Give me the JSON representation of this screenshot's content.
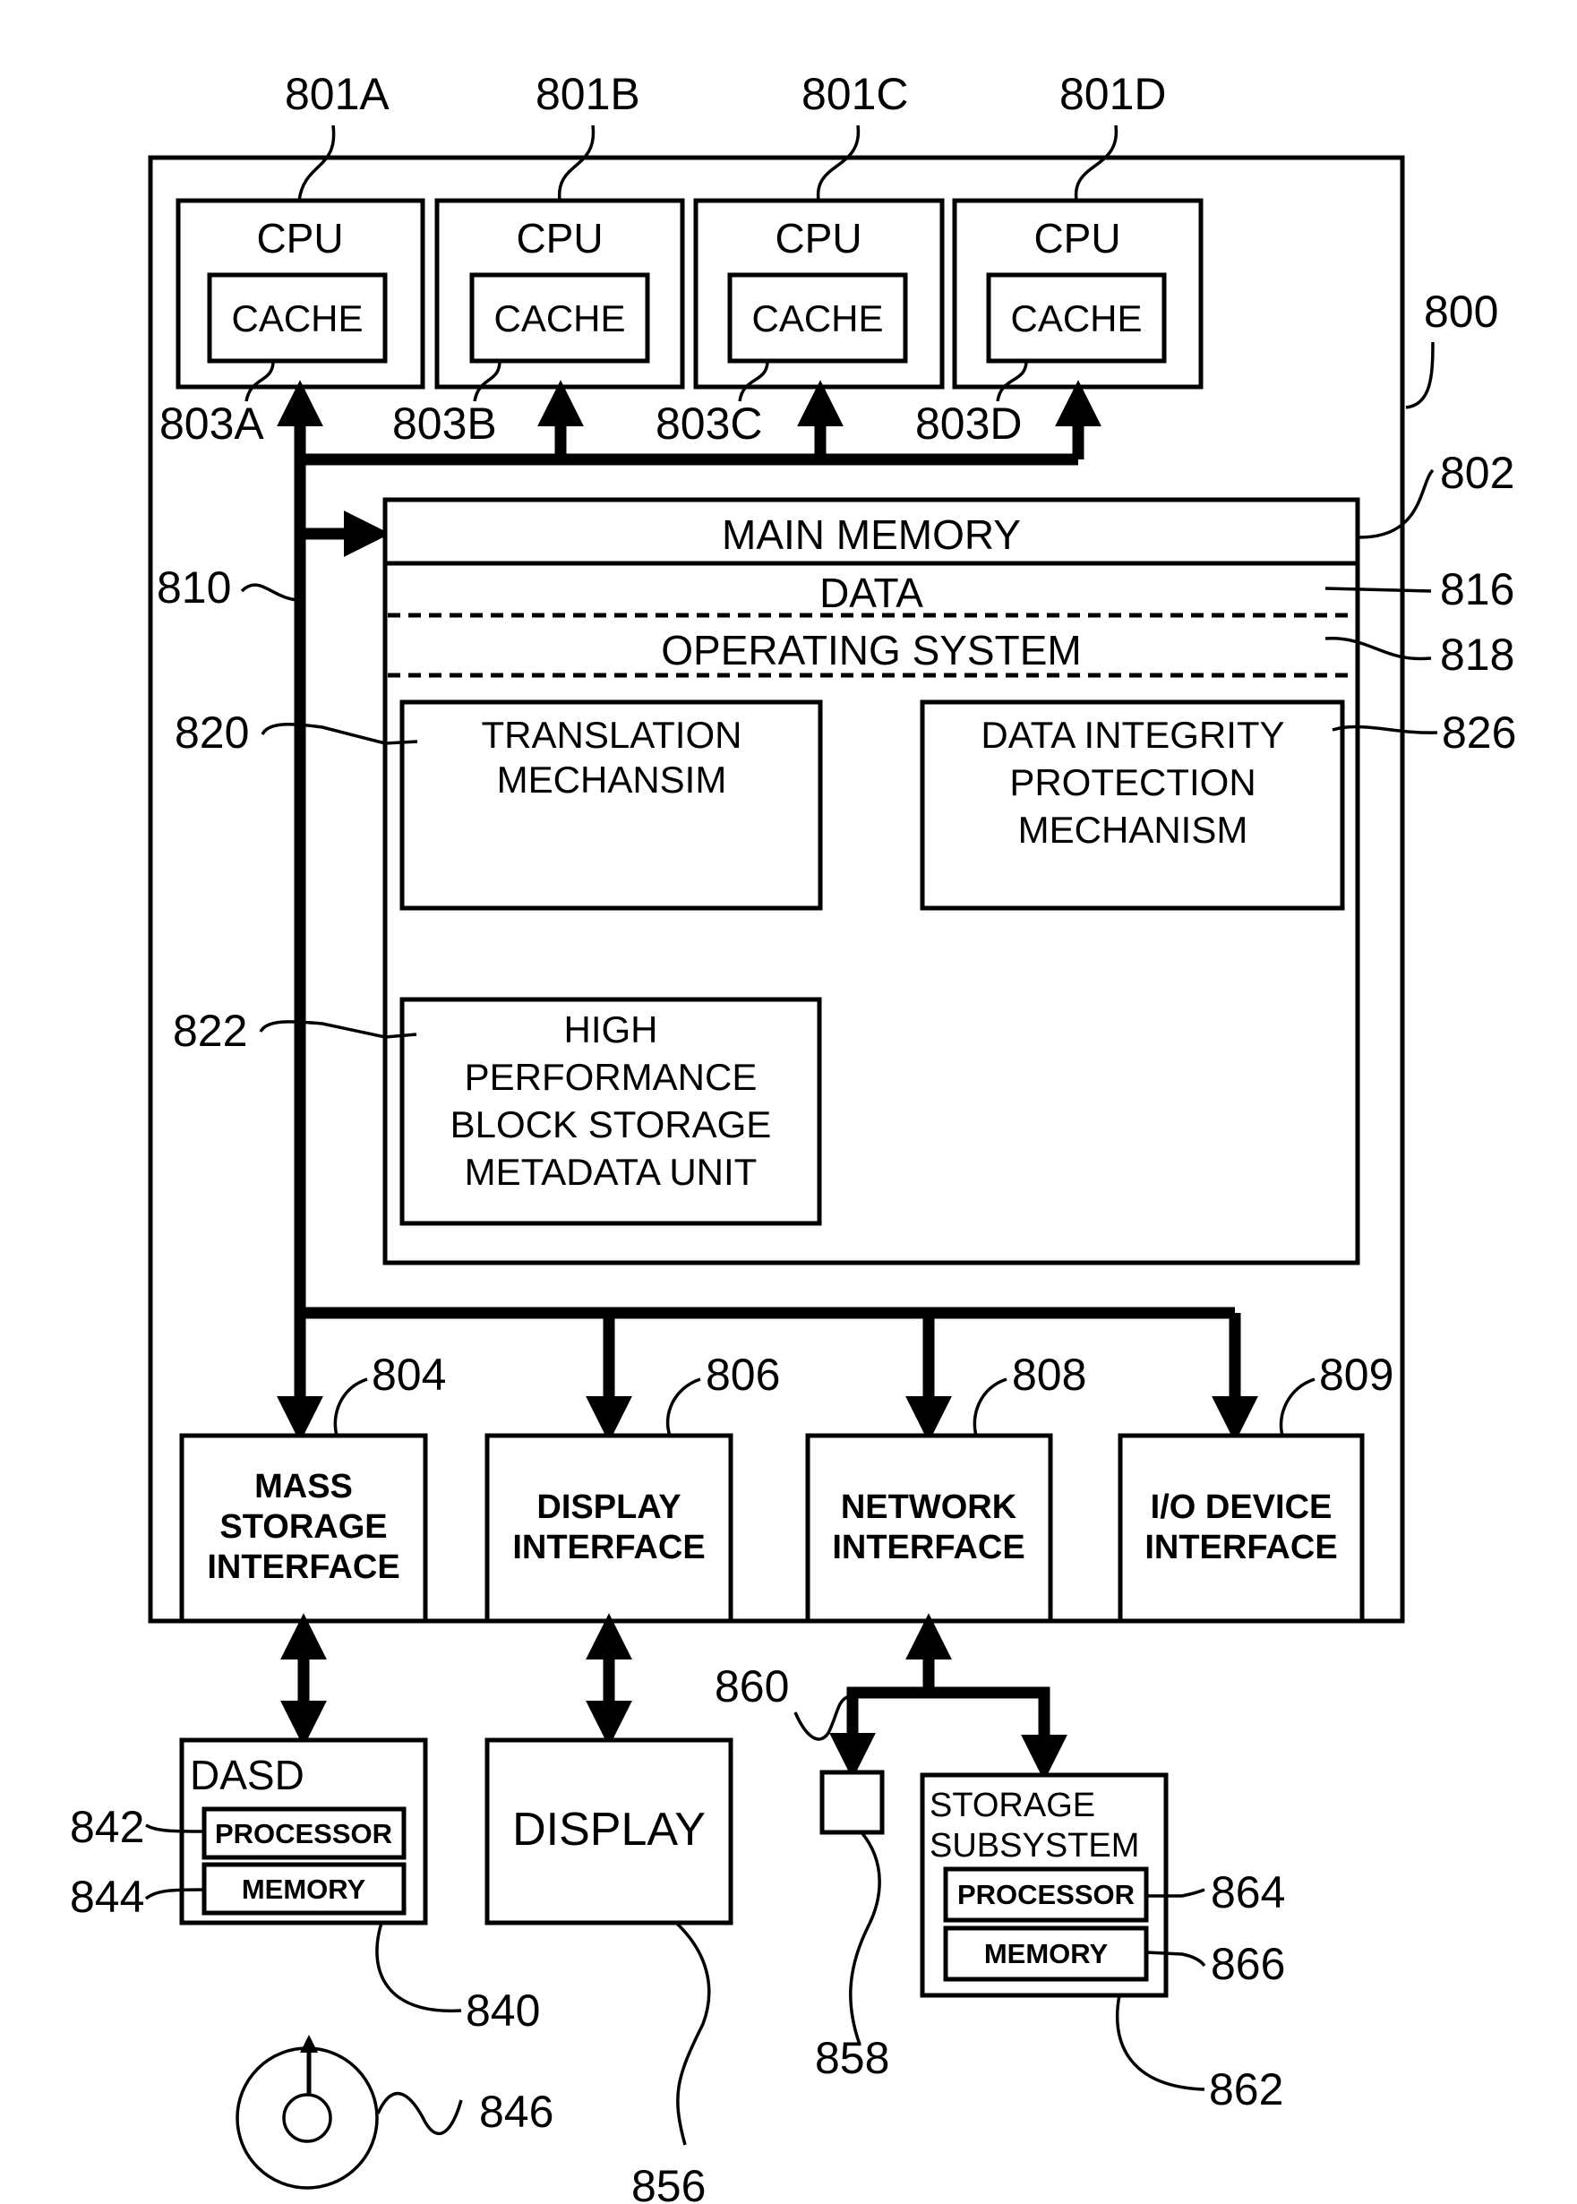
{
  "figure": {
    "system_ref": "800",
    "cpus": [
      {
        "ref": "801A",
        "label": "CPU",
        "cache_label": "CACHE",
        "cache_ref": "803A"
      },
      {
        "ref": "801B",
        "label": "CPU",
        "cache_label": "CACHE",
        "cache_ref": "803B"
      },
      {
        "ref": "801C",
        "label": "CPU",
        "cache_label": "CACHE",
        "cache_ref": "803C"
      },
      {
        "ref": "801D",
        "label": "CPU",
        "cache_label": "CACHE",
        "cache_ref": "803D"
      }
    ],
    "bus_ref": "810",
    "main_memory": {
      "ref": "802",
      "label": "MAIN MEMORY",
      "data_label": "DATA",
      "data_ref": "816",
      "os_label": "OPERATING SYSTEM",
      "os_ref": "818",
      "translation": {
        "ref": "820",
        "lines": [
          "TRANSLATION",
          "MECHANSIM"
        ]
      },
      "integrity": {
        "ref": "826",
        "lines": [
          "DATA INTEGRITY",
          "PROTECTION",
          "MECHANISM"
        ]
      },
      "metadata_unit": {
        "ref": "822",
        "lines": [
          "HIGH",
          "PERFORMANCE",
          "BLOCK STORAGE",
          "METADATA UNIT"
        ]
      }
    },
    "interfaces": [
      {
        "ref": "804",
        "lines": [
          "MASS",
          "STORAGE",
          "INTERFACE"
        ]
      },
      {
        "ref": "806",
        "lines": [
          "DISPLAY",
          "INTERFACE"
        ]
      },
      {
        "ref": "808",
        "lines": [
          "NETWORK",
          "INTERFACE"
        ]
      },
      {
        "ref": "809",
        "lines": [
          "I/O DEVICE",
          "INTERFACE"
        ]
      }
    ],
    "dasd": {
      "ref": "840",
      "label": "DASD",
      "processor_label": "PROCESSOR",
      "processor_ref": "842",
      "memory_label": "MEMORY",
      "memory_ref": "844"
    },
    "disk_ref": "846",
    "display": {
      "ref": "856",
      "label": "DISPLAY"
    },
    "network_ref": "860",
    "network_device_ref": "858",
    "storage_subsystem": {
      "ref": "862",
      "lines": [
        "STORAGE",
        "SUBSYSTEM"
      ],
      "processor_label": "PROCESSOR",
      "processor_ref": "864",
      "memory_label": "MEMORY",
      "memory_ref": "866"
    }
  }
}
